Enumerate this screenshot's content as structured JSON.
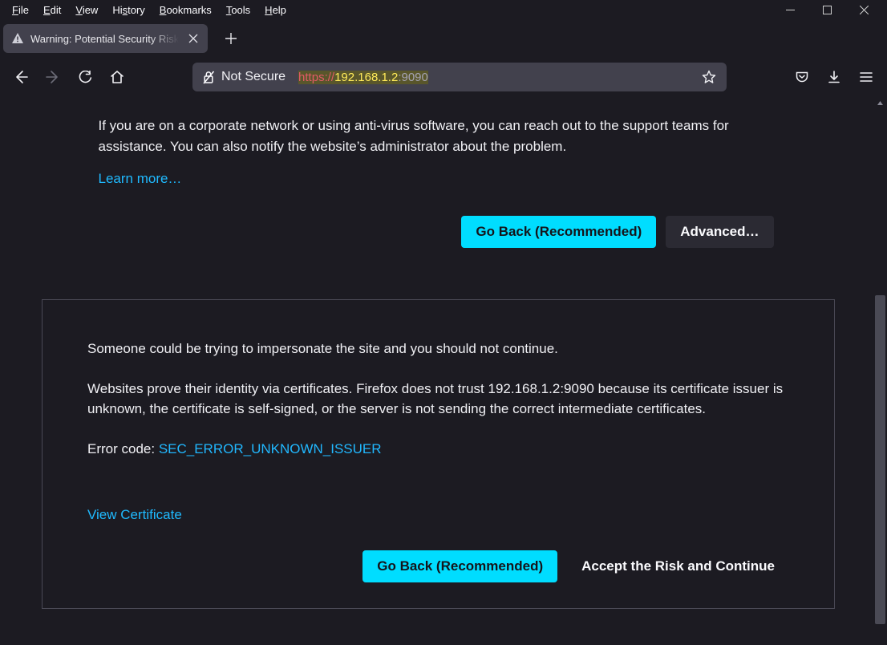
{
  "menubar": {
    "file": "File",
    "edit": "Edit",
    "view": "View",
    "history": "History",
    "bookmarks": "Bookmarks",
    "tools": "Tools",
    "help": "Help"
  },
  "tab": {
    "title": "Warning: Potential Security Risk"
  },
  "nav": {
    "not_secure": "Not Secure",
    "url_proto": "https://",
    "url_host": "192.168.1.2",
    "url_port": ":9090"
  },
  "warning": {
    "corp_para": "If you are on a corporate network or using anti-virus software, you can reach out to the support teams for assistance. You can also notify the website’s administrator about the problem.",
    "learn_more": "Learn more…",
    "go_back": "Go Back (Recommended)",
    "advanced": "Advanced…"
  },
  "advanced": {
    "impersonate": "Someone could be trying to impersonate the site and you should not continue.",
    "explain": "Websites prove their identity via certificates. Firefox does not trust 192.168.1.2:9090 because its certificate issuer is unknown, the certificate is self-signed, or the server is not sending the correct intermediate certificates.",
    "error_label": "Error code: ",
    "error_code": "SEC_ERROR_UNKNOWN_ISSUER",
    "view_cert": "View Certificate",
    "go_back": "Go Back (Recommended)",
    "accept": "Accept the Risk and Continue"
  }
}
